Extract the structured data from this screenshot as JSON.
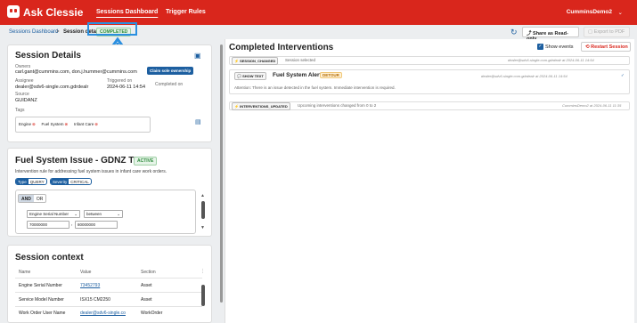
{
  "app": {
    "brand": "Ask Clessie",
    "nav": [
      "Sessions Dashboard",
      "Trigger Rules"
    ],
    "user": "CumminsDemo2"
  },
  "breadcrumb": {
    "link": "Sessions Dashboard",
    "separator": ">",
    "current": "Session detail",
    "status": "COMPLETED"
  },
  "toolbar": {
    "share": "Share as Read-only",
    "export": "Export to PDF"
  },
  "session": {
    "title": "Session Details",
    "owners_label": "Owners",
    "owners_value": "carl.gant@cummins.com, don.j.hummer@cummins.com",
    "claim_button": "Claim sole ownership",
    "assignee_label": "Assignee",
    "assignee_value": "dealer@sdv6-single.com.gdrdealr",
    "triggered_label": "Triggered on",
    "triggered_value": "2024-06-11 14:54",
    "completed_label": "Completed on",
    "completed_value": "",
    "source_label": "Source",
    "source_value": "GUIDANZ",
    "tags_label": "Tags",
    "tags": [
      "Engine",
      "Fuel System",
      "Infant Care"
    ]
  },
  "intervention": {
    "title": "Fuel System Issue - GDNZ Test",
    "status": "ACTIVE",
    "description": "Intervention rule for addressing fuel system issues in infant care work orders.",
    "type_key": "Type",
    "type_val": "QUERY",
    "severity_key": "Severity",
    "severity_val": "CRITICAL",
    "and": "AND",
    "or": "OR",
    "field": "Engine Serial Number",
    "operator": "between",
    "value_from": "70000000",
    "value_to": "80000000",
    "comma": ","
  },
  "context": {
    "title": "Session context",
    "headers": [
      "Name",
      "Value",
      "Section"
    ],
    "rows": [
      {
        "name": "Engine Serial Number",
        "value": "73452793",
        "section": "Asset"
      },
      {
        "name": "Service Model Number",
        "value": "ISX15 CM2250",
        "section": "Asset"
      },
      {
        "name": "Work Order User Name",
        "value": "dealer@sdv6-single.co",
        "section": "WorkOrder"
      }
    ]
  },
  "interventions": {
    "title": "Completed Interventions",
    "show_events": "Show events",
    "restart": "Restart Session",
    "events": [
      {
        "tag": "SESSION_CHANGED",
        "text": "Session selected",
        "meta": "dealer@sdv6-single.com.gdrdealr at 2024-06-11 14:54"
      },
      {
        "tag": "SHOW TEXT",
        "title": "Fuel System Alert",
        "badge": "DETOUR",
        "meta": "dealer@sdv6-single.com.gdrdealr at 2024-06-11 14:54",
        "text": "Attention: There is an issue detected in the fuel system. Immediate intervention is required."
      },
      {
        "tag": "INTERVENTIONS_UPDATED",
        "text": "Upcoming interventions changed from 0 to 2",
        "meta": "CumminsDemo2 at 2024-06-11 11:35"
      }
    ]
  }
}
